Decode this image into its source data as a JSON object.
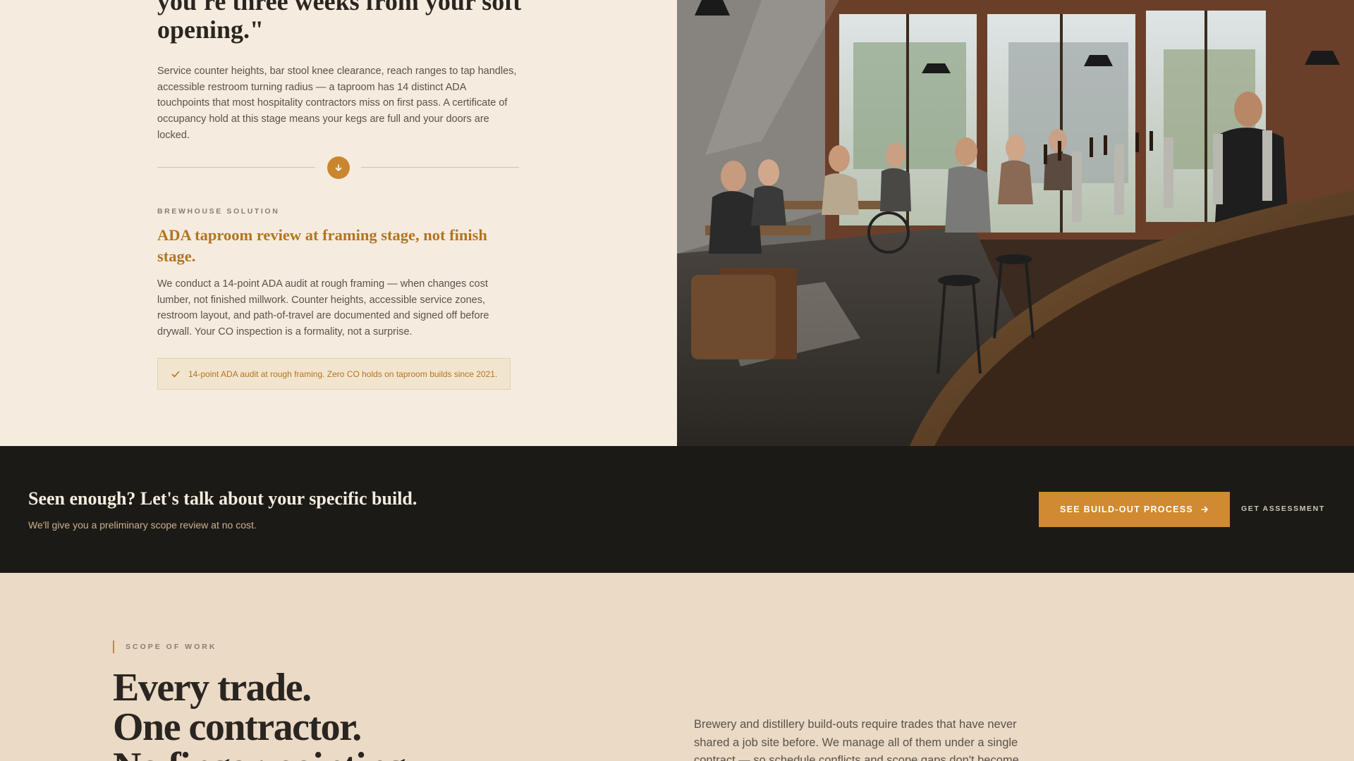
{
  "problem": {
    "quote_tail": "you're three weeks from your soft opening.\"",
    "body": "Service counter heights, bar stool knee clearance, reach ranges to tap handles, accessible restroom turning radius — a taproom has 14 distinct ADA touchpoints that most hospitality contractors miss on first pass. A certificate of occupancy hold at this stage means your kegs are full and your doors are locked."
  },
  "solution": {
    "eyebrow": "BREWHOUSE SOLUTION",
    "title": "ADA taproom review at framing stage, not finish stage.",
    "body": "We conduct a 14-point ADA audit at rough framing — when changes cost lumber, not finished millwork. Counter heights, accessible service zones, restroom layout, and path-of-travel are documented and signed off before drywall. Your CO inspection is a formality, not a surprise.",
    "proof": "14-point ADA audit at rough framing. Zero CO holds on taproom builds since 2021."
  },
  "cta": {
    "title": "Seen enough? Let's talk about your specific build.",
    "subtitle": "We'll give you a preliminary scope review at no cost.",
    "primary_label": "SEE BUILD-OUT PROCESS",
    "secondary_label": "GET ASSESSMENT"
  },
  "scope": {
    "eyebrow": "SCOPE OF WORK",
    "title_lines": [
      "Every trade.",
      "One contractor.",
      "No finger-pointing."
    ],
    "body": "Brewery and distillery build-outs require trades that have never shared a job site before. We manage all of them under a single contract — so schedule conflicts and scope gaps don't become"
  },
  "colors": {
    "accent": "#c9862e",
    "dark_band": "#1c1a16",
    "cream": "#f5ecdf"
  },
  "icons": {
    "divider": "arrow-down-icon",
    "proof": "check-icon",
    "cta": "arrow-right-icon"
  }
}
